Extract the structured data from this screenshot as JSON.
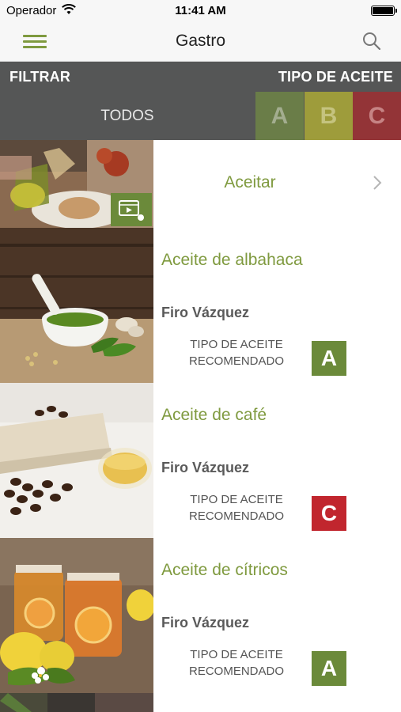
{
  "status_bar": {
    "carrier": "Operador",
    "time": "11:41 AM"
  },
  "nav": {
    "title": "Gastro",
    "menu_icon": "hamburger-icon",
    "search_icon": "search-icon"
  },
  "filter": {
    "filter_label": "FILTRAR",
    "type_label": "TIPO DE ACEITE",
    "all_label": "TODOS",
    "types": [
      {
        "label": "A",
        "color": "#6a7d48"
      },
      {
        "label": "B",
        "color": "#9e9c3b"
      },
      {
        "label": "C",
        "color": "#933437"
      }
    ]
  },
  "header_item": {
    "label": "Aceitar",
    "icon": "video-play-icon"
  },
  "recipes": [
    {
      "title": "Aceite de albahaca",
      "author": "Firo Vázquez",
      "recommended_label": "TIPO DE ACEITE RECOMENDADO",
      "type": "A",
      "type_color": "#6b8a3a"
    },
    {
      "title": "Aceite de café",
      "author": "Firo Vázquez",
      "recommended_label": "TIPO DE ACEITE RECOMENDADO",
      "type": "C",
      "type_color": "#c1262e"
    },
    {
      "title": "Aceite de cítricos",
      "author": "Firo Vázquez",
      "recommended_label": "TIPO DE ACEITE RECOMENDADO",
      "type": "A",
      "type_color": "#6b8a3a"
    }
  ]
}
